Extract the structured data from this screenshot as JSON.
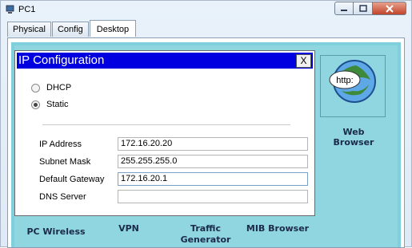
{
  "window": {
    "title": "PC1"
  },
  "tabs": [
    {
      "label": "Physical"
    },
    {
      "label": "Config"
    },
    {
      "label": "Desktop"
    }
  ],
  "dialog": {
    "title": "IP Configuration",
    "close_label": "X",
    "mode_options": [
      {
        "label": "DHCP",
        "selected": false
      },
      {
        "label": "Static",
        "selected": true
      }
    ],
    "fields": [
      {
        "label": "IP Address",
        "value": "172.16.20.20"
      },
      {
        "label": "Subnet Mask",
        "value": "255.255.255.0"
      },
      {
        "label": "Default Gateway",
        "value": "172.16.20.1"
      },
      {
        "label": "DNS Server",
        "value": ""
      }
    ]
  },
  "desktop_apps": {
    "web_browser": {
      "label": "Web Browser",
      "icon_text": "http:"
    },
    "pc_wireless": {
      "label": "PC Wireless"
    },
    "vpn": {
      "label": "VPN"
    },
    "traffic_generator": {
      "label": "Traffic Generator"
    },
    "mib_browser": {
      "label": "MIB Browser"
    }
  },
  "colors": {
    "dialog_title_bg": "#0000e0",
    "desktop_bg": "#8fd6e0",
    "app_label": "#1b2a4a"
  }
}
